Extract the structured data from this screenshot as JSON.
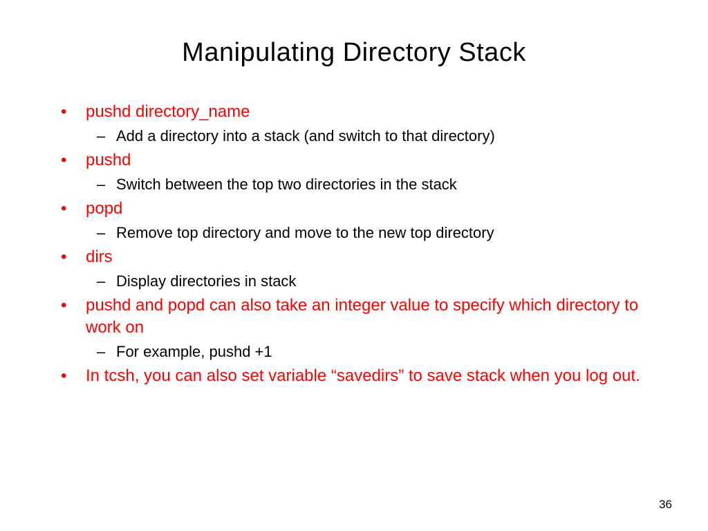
{
  "title": "Manipulating Directory Stack",
  "items": [
    {
      "label": "pushd directory_name",
      "subs": [
        "Add a directory into a stack (and switch to that directory)"
      ]
    },
    {
      "label": "pushd",
      "subs": [
        "Switch between the top two directories in the stack"
      ]
    },
    {
      "label": "popd",
      "subs": [
        "Remove top directory and move to the new top directory"
      ]
    },
    {
      "label": "dirs",
      "subs": [
        "Display directories in stack"
      ]
    },
    {
      "label": "pushd and popd can also take an integer value to specify which directory to work on",
      "subs": [
        "For example, pushd +1"
      ]
    },
    {
      "label": "In tcsh, you can also set variable “savedirs” to save stack when you log out.",
      "subs": []
    }
  ],
  "page_number": "36"
}
